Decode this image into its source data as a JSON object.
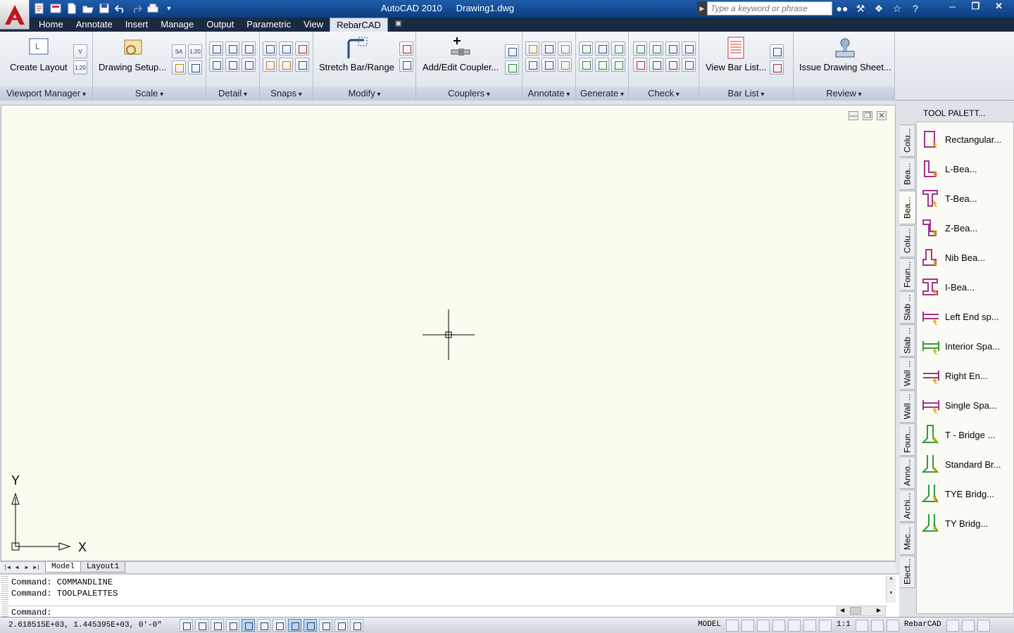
{
  "window": {
    "app_title": "AutoCAD 2010",
    "doc_title": "Drawing1.dwg"
  },
  "search": {
    "placeholder": "Type a keyword or phrase"
  },
  "colors": {
    "accent": "#1f5da8",
    "canvas": "#fcfbf0",
    "ribbon_bg": "#e4e9ef",
    "active_tab": "#dfe6ef"
  },
  "ribbon_tabs": [
    {
      "label": "Home"
    },
    {
      "label": "Annotate"
    },
    {
      "label": "Insert"
    },
    {
      "label": "Manage"
    },
    {
      "label": "Output"
    },
    {
      "label": "Parametric"
    },
    {
      "label": "View"
    },
    {
      "label": "RebarCAD",
      "active": true
    }
  ],
  "ribbon": {
    "create_layout": "Create Layout",
    "drawing_setup": "Drawing Setup...",
    "stretch_bar": "Stretch Bar/Range",
    "add_coupler": "Add/Edit Coupler...",
    "view_bar_list": "View Bar List...",
    "issue_sheet": "Issue Drawing Sheet...",
    "small_sa": "SA",
    "small_scale": "1:20",
    "panels": {
      "viewport": "Viewport Manager",
      "scale": "Scale",
      "detail": "Detail",
      "snaps": "Snaps",
      "modify": "Modify",
      "couplers": "Couplers",
      "annotate": "Annotate",
      "generate": "Generate",
      "check": "Check",
      "barlist": "Bar List",
      "review": "Review"
    }
  },
  "layout_tabs": [
    {
      "label": "Model"
    },
    {
      "label": "Layout1"
    }
  ],
  "command": {
    "history": [
      "Command: COMMANDLINE",
      "Command: TOOLPALETTES"
    ],
    "prompt": "Command:"
  },
  "status": {
    "coords": "2.618515E+03, 1.445395E+03, 0'-0\"",
    "space": "MODEL",
    "annotation_scale": "1:1",
    "workspace": "RebarCAD"
  },
  "ucs": {
    "x_label": "X",
    "y_label": "Y"
  },
  "palette": {
    "title": "TOOL PALETT...",
    "tabs": [
      "Colu...",
      "Bea...",
      "Bea...",
      "Colu...",
      "Foun...",
      "Slab ...",
      "Slab ...",
      "Wall ...",
      "Wall ...",
      "Foun...",
      "Anno...",
      "Archi...",
      "Mec...",
      "Elect..."
    ],
    "items": [
      {
        "label": "Rectangular...",
        "color": "#a0348a"
      },
      {
        "label": "L-Bea...",
        "color": "#a0348a"
      },
      {
        "label": "T-Bea...",
        "color": "#a0348a"
      },
      {
        "label": "Z-Bea...",
        "color": "#a0348a"
      },
      {
        "label": "Nib Bea...",
        "color": "#a0348a"
      },
      {
        "label": "I-Bea...",
        "color": "#a0348a"
      },
      {
        "label": "Left End sp...",
        "color": "#a0348a"
      },
      {
        "label": "Interior Spa...",
        "color": "#2f9a3a"
      },
      {
        "label": "Right En...",
        "color": "#a0348a"
      },
      {
        "label": "Single Spa...",
        "color": "#a0348a"
      },
      {
        "label": "T - Bridge ...",
        "color": "#2f9a3a"
      },
      {
        "label": "Standard Br...",
        "color": "#2f9a3a"
      },
      {
        "label": "TYE Bridg...",
        "color": "#2f9a3a"
      },
      {
        "label": "TY Bridg...",
        "color": "#2f9a3a"
      }
    ]
  }
}
